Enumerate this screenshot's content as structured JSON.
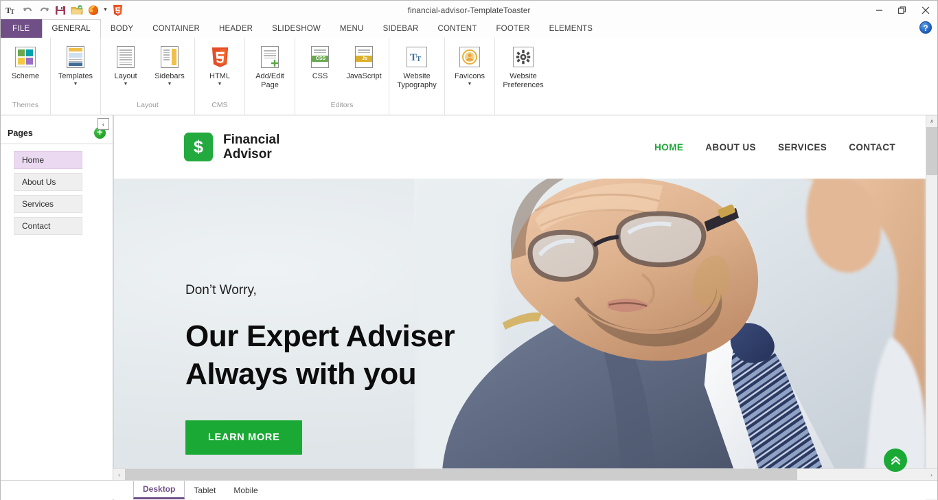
{
  "window": {
    "title": "financial-advisor-TemplateToaster",
    "minimize": "—",
    "restore": "❐",
    "close": "✕",
    "help": "?"
  },
  "quick_access": [
    {
      "name": "typography-icon",
      "glyph": "Tᴛ"
    },
    {
      "name": "undo-icon",
      "glyph": "↶"
    },
    {
      "name": "redo-icon",
      "glyph": "↷"
    },
    {
      "name": "save-icon",
      "glyph": "Ὃe"
    },
    {
      "name": "open-folder-icon",
      "glyph": "Ὄ2"
    },
    {
      "name": "firefox-preview-icon",
      "glyph": "●"
    },
    {
      "name": "html5-icon",
      "glyph": "5"
    }
  ],
  "ribbon": {
    "file_tab": "FILE",
    "tabs": [
      {
        "label": "GENERAL",
        "active": true
      },
      {
        "label": "BODY",
        "active": false
      },
      {
        "label": "CONTAINER",
        "active": false
      },
      {
        "label": "HEADER",
        "active": false
      },
      {
        "label": "SLIDESHOW",
        "active": false
      },
      {
        "label": "MENU",
        "active": false
      },
      {
        "label": "SIDEBAR",
        "active": false
      },
      {
        "label": "CONTENT",
        "active": false
      },
      {
        "label": "FOOTER",
        "active": false
      },
      {
        "label": "ELEMENTS",
        "active": false
      }
    ],
    "groups": [
      {
        "label": "Themes",
        "items": [
          {
            "label": "Scheme",
            "icon": "color-scheme-icon",
            "caret": false
          },
          {
            "label": "Templates",
            "icon": "templates-icon",
            "caret": true
          }
        ]
      },
      {
        "label": "Layout",
        "items": [
          {
            "label": "Layout",
            "icon": "layout-icon",
            "caret": true
          },
          {
            "label": "Sidebars",
            "icon": "sidebars-icon",
            "caret": true
          }
        ]
      },
      {
        "label": "CMS",
        "items": [
          {
            "label": "HTML",
            "icon": "html5-icon",
            "caret": true
          }
        ]
      },
      {
        "label": "",
        "items": [
          {
            "label": "Add/Edit Page",
            "icon": "add-edit-page-icon",
            "caret": false
          }
        ]
      },
      {
        "label": "Editors",
        "items": [
          {
            "label": "CSS",
            "icon": "css-file-icon",
            "caret": false
          },
          {
            "label": "JavaScript",
            "icon": "js-file-icon",
            "caret": false
          }
        ]
      },
      {
        "label": "",
        "items": [
          {
            "label": "Website Typography",
            "icon": "website-typography-icon",
            "caret": false
          },
          {
            "label": "Favicons",
            "icon": "favicons-icon",
            "caret": true
          },
          {
            "label": "Website Preferences",
            "icon": "website-preferences-icon",
            "caret": false
          }
        ]
      }
    ],
    "css_badge": "CSS",
    "js_badge": "Js",
    "html5_badge": "5",
    "typography_glyph": "Tᴛ",
    "gear_glyph": "⚙"
  },
  "pages_panel": {
    "title": "Pages",
    "add_label": "+",
    "collapse_label": "‹",
    "items": [
      {
        "label": "Home",
        "active": true
      },
      {
        "label": "About Us",
        "active": false
      },
      {
        "label": "Services",
        "active": false
      },
      {
        "label": "Contact",
        "active": false
      }
    ]
  },
  "preview": {
    "brand": {
      "symbol": "$",
      "line1": "Financial",
      "line2": "Advisor"
    },
    "nav": [
      {
        "label": "HOME",
        "active": true
      },
      {
        "label": "ABOUT US",
        "active": false
      },
      {
        "label": "SERVICES",
        "active": false
      },
      {
        "label": "CONTACT",
        "active": false
      }
    ],
    "hero": {
      "kicker": "Don’t Worry,",
      "title_line1": "Our Expert Adviser",
      "title_line2": "Always with you",
      "button": "LEARN MORE",
      "to_top_glyph": "»"
    }
  },
  "scrollbars": {
    "up": "∧",
    "down": "∨",
    "left": "‹",
    "right": "›"
  },
  "device_tabs": [
    {
      "label": "Desktop",
      "active": true
    },
    {
      "label": "Tablet",
      "active": false
    },
    {
      "label": "Mobile",
      "active": false
    }
  ],
  "colors": {
    "accent_purple": "#6f4f86",
    "brand_green": "#1aa935",
    "active_page_bg": "#ead9f0"
  }
}
